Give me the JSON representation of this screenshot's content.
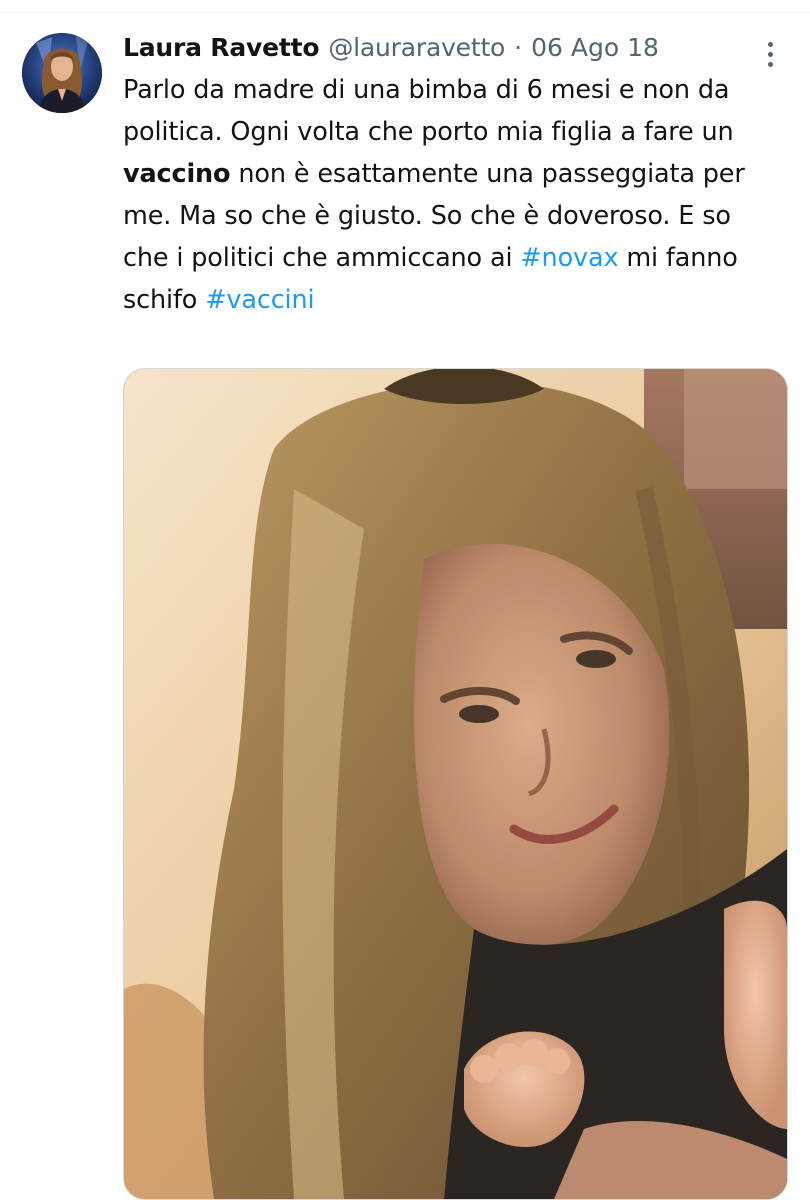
{
  "tweet": {
    "author": {
      "display_name": "Laura Ravetto",
      "handle": "@lauraravetto",
      "avatar_icon": "profile-photo"
    },
    "separator": "·",
    "date": "06 Ago 18",
    "more_icon": "more-vertical-icon",
    "text": {
      "p1": "Parlo da madre di una bimba di 6 mesi e non da politica. Ogni volta che porto mia figlia a fare un ",
      "bold": "vaccino",
      "p2": " non è esattamente una passeggiata per me. Ma so che è giusto. So che è doveroso. E so che i politici che ammiccano ai ",
      "hashtag1": "#novax",
      "p3": " mi fanno schifo ",
      "hashtag2": "#vaccini"
    },
    "media": {
      "kind": "photo"
    },
    "colors": {
      "text": "#0f1419",
      "secondary": "#536471",
      "link": "#1d9bf0",
      "border": "#cfd9de"
    }
  }
}
